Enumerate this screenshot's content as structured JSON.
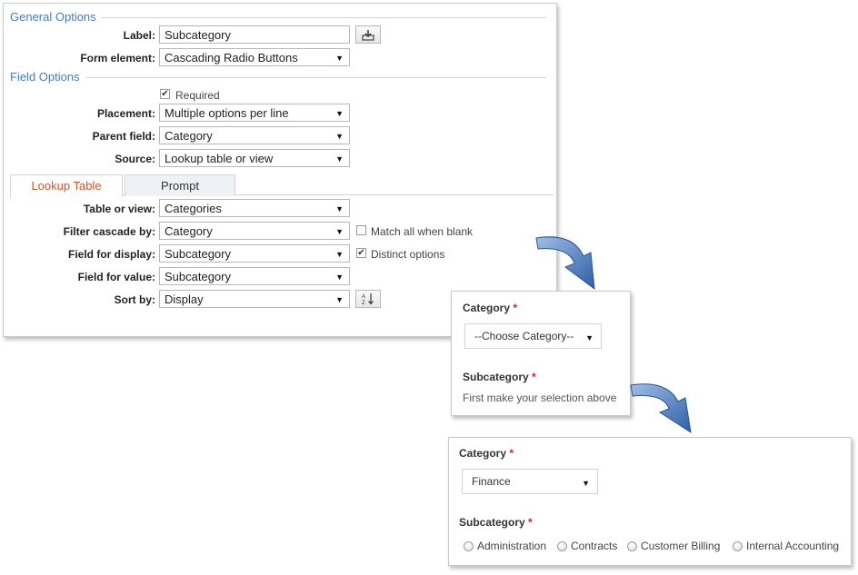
{
  "config": {
    "general_options_title": "General Options",
    "label_label": "Label:",
    "label_value": "Subcategory",
    "form_element_label": "Form element:",
    "form_element_value": "Cascading Radio Buttons",
    "field_options_title": "Field Options",
    "required_label": "Required",
    "required_checked": true,
    "placement_label": "Placement:",
    "placement_value": "Multiple options per line",
    "parent_field_label": "Parent field:",
    "parent_field_value": "Category",
    "source_label": "Source:",
    "source_value": "Lookup table or view",
    "tabs": [
      {
        "label": "Lookup Table",
        "active": true
      },
      {
        "label": "Prompt",
        "active": false
      }
    ],
    "table_or_view_label": "Table or view:",
    "table_or_view_value": "Categories",
    "filter_cascade_label": "Filter cascade by:",
    "filter_cascade_value": "Category",
    "match_all_label": "Match all when blank",
    "match_all_checked": false,
    "field_display_label": "Field for display:",
    "field_display_value": "Subcategory",
    "distinct_label": "Distinct options",
    "distinct_checked": true,
    "field_value_label": "Field for value:",
    "field_value_value": "Subcategory",
    "sort_by_label": "Sort by:",
    "sort_by_value": "Display"
  },
  "preview1": {
    "category_label": "Category",
    "required_mark": "*",
    "category_select_value": "--Choose Category--",
    "subcategory_label": "Subcategory",
    "help_text": "First make your selection above"
  },
  "preview2": {
    "category_label": "Category",
    "required_mark": "*",
    "category_select_value": "Finance",
    "subcategory_label": "Subcategory",
    "options": [
      "Administration",
      "Contracts",
      "Customer Billing",
      "Internal Accounting"
    ]
  },
  "icons": {
    "dropdown": "▼",
    "check": "✔",
    "insert_field": "insert-field-icon",
    "sort_az": "sort-az-icon"
  },
  "colors": {
    "section_title": "#4a7ab8",
    "active_tab": "#d2542c",
    "required_star": "#cc2222",
    "flow_arrow": "#3f6fb3"
  }
}
